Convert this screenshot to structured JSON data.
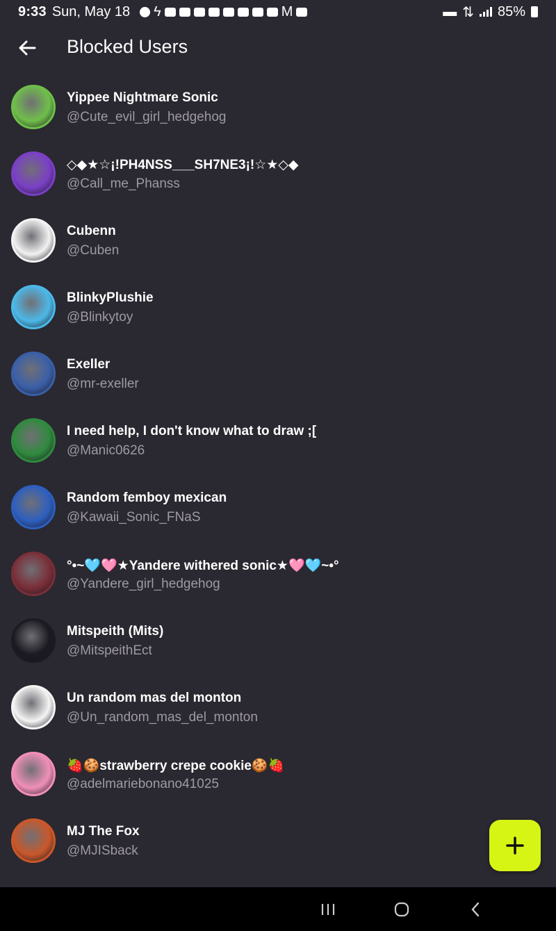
{
  "status_bar": {
    "time": "9:33",
    "date": "Sun, May 18",
    "battery": "85%"
  },
  "header": {
    "title": "Blocked Users",
    "back_icon": "arrow-left-icon"
  },
  "blocked_users": [
    {
      "name": "Yippee Nightmare Sonic",
      "handle": "@Cute_evil_girl_hedgehog",
      "avatar_color": "#6fbf4a"
    },
    {
      "name": "◇◆★☆¡!PH4NSS___SH7NE3¡!☆★◇◆",
      "handle": "@Call_me_Phanss",
      "avatar_color": "#7a3fc6"
    },
    {
      "name": "Cubenn",
      "handle": "@Cuben",
      "avatar_color": "#f2f2f2"
    },
    {
      "name": "BlinkyPlushie",
      "handle": "@Blinkytoy",
      "avatar_color": "#4cb8e8"
    },
    {
      "name": "Exeller",
      "handle": "@mr-exeller",
      "avatar_color": "#3a5fa8"
    },
    {
      "name": "I need help, I don't know what to draw ;[",
      "handle": "@Manic0626",
      "avatar_color": "#2f8a3e"
    },
    {
      "name": "Random femboy mexican",
      "handle": "@Kawaii_Sonic_FNaS",
      "avatar_color": "#2d5fbf"
    },
    {
      "name": "°•~🩵🩷★Yandere withered sonic★🩷🩵~•°",
      "handle": "@Yandere_girl_hedgehog",
      "avatar_color": "#7a2f38"
    },
    {
      "name": "Mitspeith (Mits)",
      "handle": "@MitspeithEct",
      "avatar_color": "#1b1a22"
    },
    {
      "name": "Un random mas del monton",
      "handle": "@Un_random_mas_del_monton",
      "avatar_color": "#f4f4f4"
    },
    {
      "name": "🍓🍪strawberry crepe cookie🍪🍓",
      "handle": "@adelmariebonano41025",
      "avatar_color": "#f08fb8"
    },
    {
      "name": "MJ The Fox",
      "handle": "@MJISback",
      "avatar_color": "#c9582a"
    }
  ],
  "fab": {
    "icon": "plus-icon",
    "color": "#d7f515"
  },
  "nav": {
    "recents_icon": "recents-icon",
    "home_icon": "home-icon",
    "back_icon": "back-chevron-icon"
  }
}
